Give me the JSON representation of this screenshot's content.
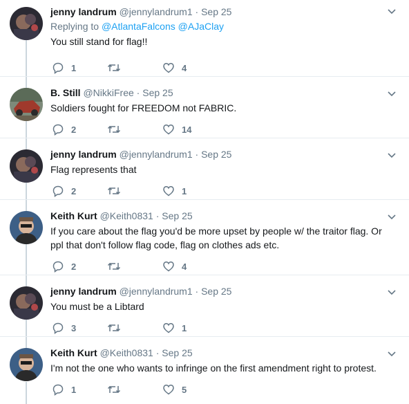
{
  "tweets": [
    {
      "name": "jenny landrum",
      "handle": "@jennylandrum1",
      "time": "Sep 25",
      "replying_label": "Replying to",
      "replying_to": [
        "@AtlantaFalcons",
        "@AJaClay"
      ],
      "text": "You still stand for flag!!",
      "replies": "1",
      "retweets": "",
      "likes": "4"
    },
    {
      "name": "B. Still",
      "handle": "@NikkiFree",
      "time": "Sep 25",
      "text": "Soldiers fought for FREEDOM not FABRIC.",
      "replies": "2",
      "retweets": "",
      "likes": "14"
    },
    {
      "name": "jenny landrum",
      "handle": "@jennylandrum1",
      "time": "Sep 25",
      "text": "Flag represents that",
      "replies": "2",
      "retweets": "",
      "likes": "1"
    },
    {
      "name": "Keith Kurt",
      "handle": "@Keith0831",
      "time": "Sep 25",
      "text": "If you care about the flag you'd be more upset by people w/ the traitor flag. Or ppl that don't follow flag code, flag on clothes ads etc.",
      "replies": "2",
      "retweets": "",
      "likes": "4"
    },
    {
      "name": "jenny landrum",
      "handle": "@jennylandrum1",
      "time": "Sep 25",
      "text": "You must be a Libtard",
      "replies": "3",
      "retweets": "",
      "likes": "1"
    },
    {
      "name": "Keith Kurt",
      "handle": "@Keith0831",
      "time": "Sep 25",
      "text": "I'm not the one who wants to infringe on the first amendment right to protest.",
      "replies": "1",
      "retweets": "",
      "likes": "5"
    }
  ],
  "icons": {
    "reply": "reply-icon",
    "retweet": "retweet-icon",
    "like": "heart-icon",
    "more": "chevron-down-icon"
  },
  "colors": {
    "name": "#14171a",
    "secondary": "#657786",
    "link": "#1da1f2",
    "thread_line": "#ccd6dd",
    "divider": "#e6ecf0"
  }
}
